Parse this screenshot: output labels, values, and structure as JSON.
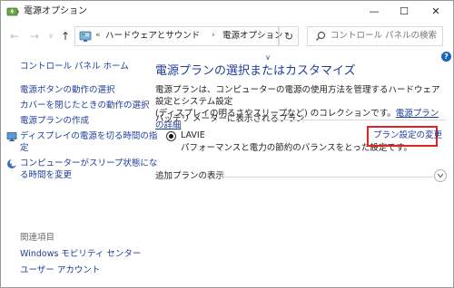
{
  "window": {
    "title": "電源オプション",
    "minimize_glyph": "—",
    "maximize_glyph": "☐",
    "close_glyph": "✕"
  },
  "nav": {
    "back_glyph": "←",
    "forward_glyph": "→",
    "recent_glyph": "∨",
    "up_glyph": "↑",
    "breadcrumb_prefix": "«",
    "breadcrumb": [
      "ハードウェアとサウンド",
      "電源オプション"
    ],
    "breadcrumb_sep": "›",
    "dropdown_glyph": "∨",
    "refresh_glyph": "↻",
    "search_placeholder": "コントロール パネルの検索"
  },
  "help_glyph": "?",
  "sidebar": {
    "home": "コントロール パネル ホーム",
    "links": [
      "電源ボタンの動作の選択",
      "カバーを閉じたときの動作の選択",
      "電源プランの作成",
      "ディスプレイの電源を切る時間の指定",
      "コンピューターがスリープ状態になる時間を変更"
    ],
    "links_wrapped": [
      "ディスプレイの電源を切る時間の指",
      "定",
      "コンピューターがスリープ状態にな",
      "る時間を変更"
    ],
    "related_title": "関連項目",
    "related_links": [
      "Windows モビリティ センター",
      "ユーザー アカウント"
    ]
  },
  "main": {
    "title": "電源プランの選択またはカスタマイズ",
    "description_line1": "電源プランは、コンピューターの電源の使用方法を管理するハードウェア設定とシステム設定",
    "description_line2": "(ディスプレイの明るさやスリープなど) のコレクションです。",
    "description_link": "電源プランの詳細",
    "battery_section_label": "バッテリ メーターに表示されるプラン",
    "plan_name": "LAVIE",
    "plan_description": "パフォーマンスと電力の節約のバランスをとった設定です。",
    "change_plan_link": "プラン設定の変更",
    "additional_plans_label": "追加プランの表示"
  },
  "colors": {
    "link": "#1f3e99",
    "highlight_box": "#e52222",
    "help_icon": "#1565c0"
  }
}
